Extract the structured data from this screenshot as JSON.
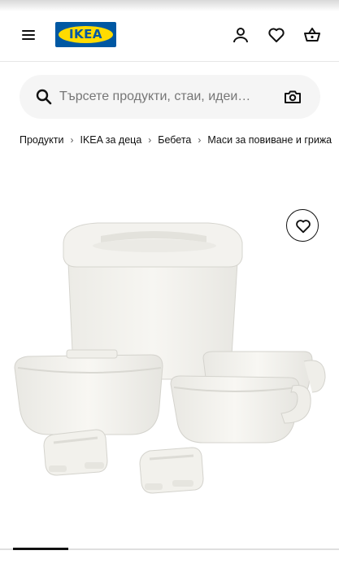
{
  "header": {
    "logo_text": "IKEA",
    "menu_icon": "hamburger-menu-icon",
    "profile_icon": "person-icon",
    "favourites_icon": "heart-icon",
    "cart_icon": "shopping-bag-icon"
  },
  "search": {
    "placeholder": "Търсете продукти, стаи, идеи…",
    "search_icon": "search-icon",
    "camera_icon": "camera-icon"
  },
  "breadcrumb": {
    "items": [
      "Продукти",
      "IKEA за деца",
      "Бебета",
      "Маси за повиване и грижа"
    ],
    "separator": "›"
  },
  "product": {
    "favourite_icon": "heart-icon",
    "image_icon": "diaper-pail-and-storage-bowls-image",
    "gallery": {
      "active_index": 1
    }
  },
  "colors": {
    "ikea_blue": "#0058a3",
    "ikea_yellow": "#ffdb00",
    "search_bg": "#f5f5f5"
  }
}
